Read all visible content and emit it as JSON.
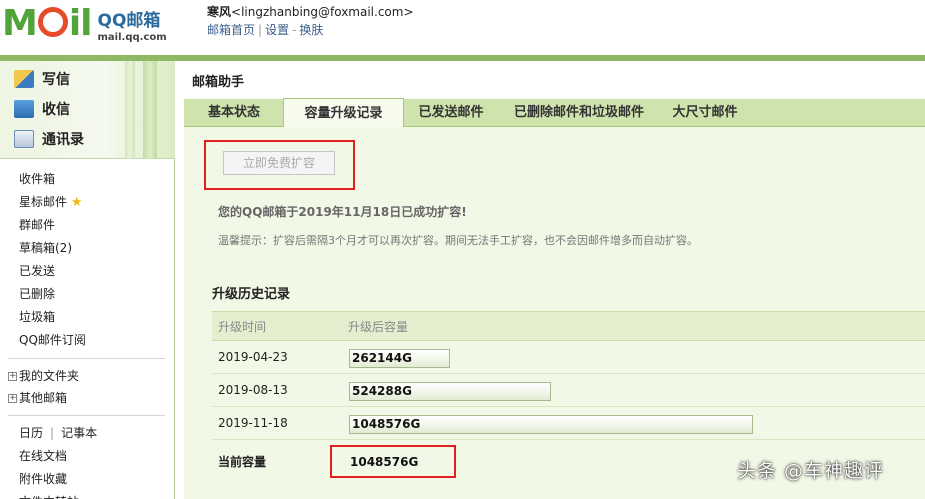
{
  "header": {
    "logo_text": "M",
    "logo_text2": "il",
    "logo_qq": "QQ邮箱",
    "logo_url": "mail.qq.com",
    "user_name": "寒风",
    "user_email": "<lingzhanbing@foxmail.com>",
    "links": [
      "邮箱首页",
      "设置",
      "换肤"
    ],
    "link_sep1": "|",
    "link_sep2": "-"
  },
  "sidebar": {
    "main_items": [
      {
        "label": "写信",
        "icon": "write-icon"
      },
      {
        "label": "收信",
        "icon": "inbox-icon"
      },
      {
        "label": "通讯录",
        "icon": "contacts-icon"
      }
    ],
    "folders": [
      "收件箱",
      "星标邮件",
      "群邮件",
      "草稿箱(2)",
      "已发送",
      "已删除",
      "垃圾箱",
      "QQ邮件订阅"
    ],
    "star": "★",
    "trees": [
      "我的文件夹",
      "其他邮箱"
    ],
    "tree_plus": "+",
    "calendar": "日历",
    "notepad": "记事本",
    "cal_sep": "|",
    "tools": [
      "在线文档",
      "附件收藏",
      "文件中转站"
    ]
  },
  "main": {
    "title": "邮箱助手",
    "tabs": [
      "基本状态",
      "容量升级记录",
      "已发送邮件",
      "已删除邮件和垃圾邮件",
      "大尺寸邮件"
    ],
    "active_tab": 1,
    "expand_button": "立即免费扩容",
    "success_message": "您的QQ邮箱于2019年11月18日已成功扩容!",
    "tip": "温馨提示：扩容后需隔3个月才可以再次扩容。期间无法手工扩容，也不会因邮件增多而自动扩容。",
    "history_title": "升级历史记录",
    "columns": [
      "升级时间",
      "升级后容量"
    ],
    "rows": [
      {
        "date": "2019-04-23",
        "capacity": "262144G",
        "fill": 0.25
      },
      {
        "date": "2019-08-13",
        "capacity": "524288G",
        "fill": 0.5
      },
      {
        "date": "2019-11-18",
        "capacity": "1048576G",
        "fill": 1.0
      }
    ],
    "current_label": "当前容量",
    "current_value": "1048576G"
  },
  "watermark": "头条 @车神趣评",
  "colors": {
    "brand_green": "#52a33a",
    "accent_green": "#8fb865",
    "highlight_red": "#e02020",
    "link_blue": "#3a5e8c"
  }
}
